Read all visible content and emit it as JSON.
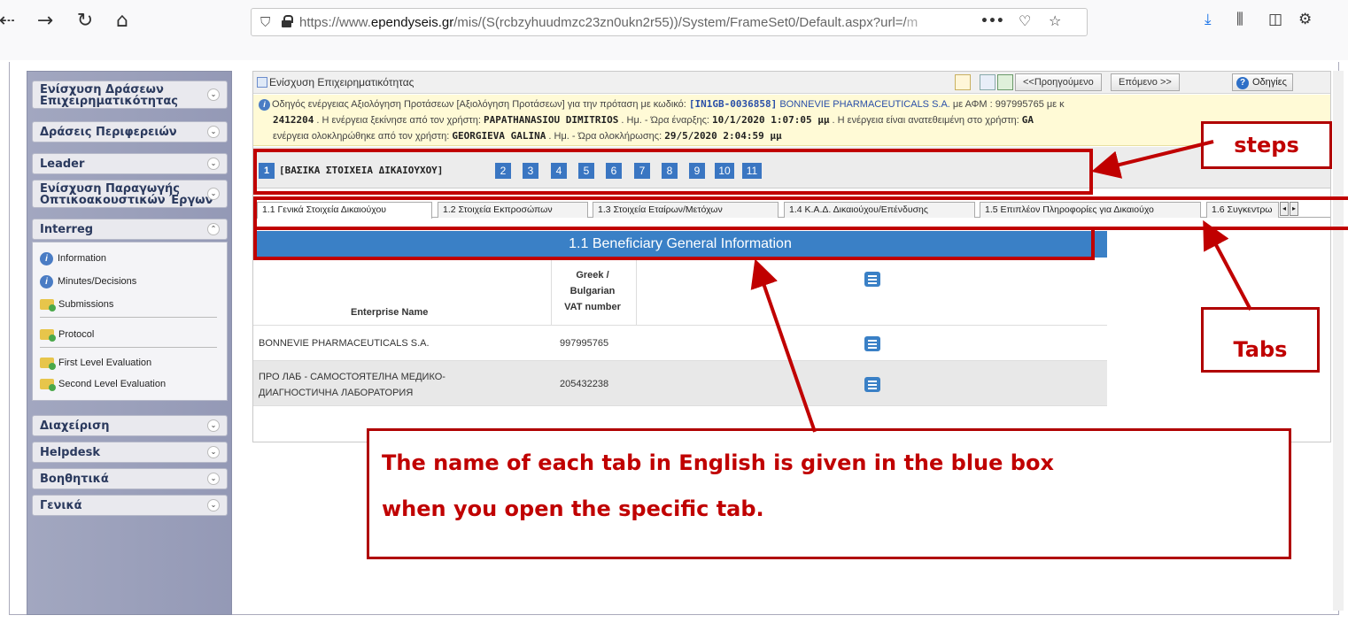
{
  "browser": {
    "url_host": "https://www.",
    "url_domain": "ependyseis.gr",
    "url_path": "/mis/(S(rcbzyhuudmzc23zn0ukn2r55))/System/FrameSet0/Default.aspx?url=/",
    "url_tail": "m",
    "more_icon": "•••"
  },
  "sidebar": {
    "groups": [
      {
        "label": "Ενίσχυση Δράσεων Επιχειρηματικότητας"
      },
      {
        "label": "Δράσεις Περιφερειών"
      },
      {
        "label": "Leader"
      },
      {
        "label": "Ενίσχυση Παραγωγής Οπτικοακουστικών Έργων"
      },
      {
        "label": "Interreg"
      },
      {
        "label": "Διαχείριση"
      },
      {
        "label": "Helpdesk"
      },
      {
        "label": "Βοηθητικά"
      },
      {
        "label": "Γενικά"
      }
    ],
    "interreg_items": [
      {
        "label": "Information",
        "icon": "info-icon"
      },
      {
        "label": "Minutes/Decisions",
        "icon": "info-icon"
      },
      {
        "label": "Submissions",
        "icon": "folder-icon"
      },
      {
        "label": "Protocol",
        "icon": "folder-icon"
      },
      {
        "label": "First Level Evaluation",
        "icon": "folder-icon"
      },
      {
        "label": "Second Level Evaluation",
        "icon": "folder-icon"
      }
    ]
  },
  "main": {
    "title": "Ενίσχυση Επιχειρηματικότητας",
    "prev_label": "<<Προηγούμενο",
    "next_label": "Επόμενο >>",
    "help_label": "Οδηγίες",
    "info": {
      "line1_a": "Οδηγός ενέργειας Αξιολόγηση Προτάσεων [Αξιολόγηση Προτάσεων] για την πρόταση με κωδικό: ",
      "code": "[IN1GB-0036858]",
      "line1_b": " BONNEVIE PHARMACEUTICALS S.A.",
      "line1_c": " με ΑΦΜ : 997995765 με κ",
      "line2_a": "2412204",
      "line2_b": " . Η ενέργεια ξεκίνησε από τον χρήστη: ",
      "line2_user": "PAPATHANASIOU DIMITRIOS",
      "line2_c": " . Ημ. - Ώρα έναρξης: ",
      "line2_date": "10/1/2020 1:07:05 μμ",
      "line2_d": " . Η ενέργεια είναι ανατεθειμένη στο χρήστη: ",
      "line2_e": "GA",
      "line3_a": "ενέργεια ολοκληρώθηκε από τον χρήστη: ",
      "line3_user": "GEORGIEVA GALINA",
      "line3_b": " . Ημ. - Ώρα ολοκλήρωσης: ",
      "line3_date": "29/5/2020 2:04:59 μμ"
    },
    "step_first_num": "1",
    "step_first_label": "[ΒΑΣΙΚΑ ΣΤΟΙΧΕΙΑ ΔΙΚΑΙΟΥΧΟΥ]",
    "steps": [
      "2",
      "3",
      "4",
      "5",
      "6",
      "7",
      "8",
      "9",
      "10",
      "11"
    ],
    "tabs": [
      "1.1 Γενικά Στοιχεία Δικαιούχου",
      "1.2 Στοιχεία Εκπροσώπων",
      "1.3 Στοιχεία Εταίρων/Μετόχων",
      "1.4 Κ.Α.Δ. Δικαιούχου/Επένδυσης",
      "1.5 Επιπλέον Πληροφορίες για Δικαιούχο",
      "1.6 Συγκεντρω"
    ],
    "section_title": "1.1 Beneficiary General Information",
    "table": {
      "col_name": "Enterprise Name",
      "col_vat_1": "Greek /",
      "col_vat_2": "Bulgarian",
      "col_vat_3": "VAT number",
      "rows": [
        {
          "name_1": "BONNEVIE PHARMACEUTICALS S.A.",
          "name_2": "",
          "vat": "997995765"
        },
        {
          "name_1": "ПРО ЛАБ - САМОСТОЯТЕЛНА МЕДИКО-",
          "name_2": "ДИАГНОСТИЧНА ЛАБОРАТОРИЯ",
          "vat": "205432238"
        }
      ]
    }
  },
  "annotations": {
    "steps_label": "steps",
    "tabs_label": "Tabs",
    "note_line1": "The name of each tab in English is given in the blue box",
    "note_line2": "when you open the specific tab."
  },
  "colors": {
    "annotation_red": "#c00000",
    "step_blue": "#3a76c2",
    "section_blue": "#3a80c6",
    "sidebar_bg": "#9499b6"
  }
}
